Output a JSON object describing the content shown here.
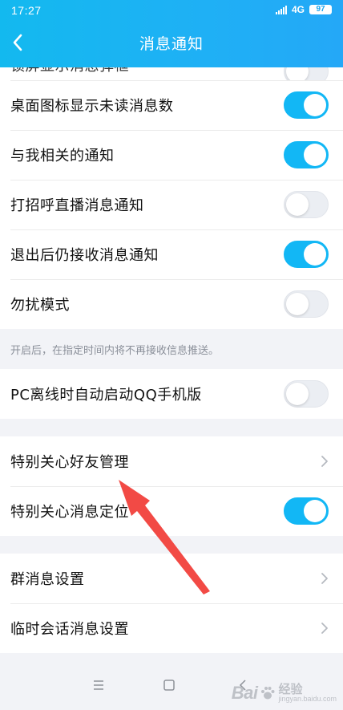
{
  "status_bar": {
    "time": "17:27",
    "network": "4G",
    "battery": "97"
  },
  "header": {
    "title": "消息通知"
  },
  "rows": {
    "cut": {
      "label": "锁屏显示消息弹框",
      "on": false
    },
    "desktop_badge": {
      "label": "桌面图标显示未读消息数",
      "on": true
    },
    "related": {
      "label": "与我相关的通知",
      "on": true
    },
    "greet_live": {
      "label": "打招呼直播消息通知",
      "on": false
    },
    "after_exit": {
      "label": "退出后仍接收消息通知",
      "on": true
    },
    "dnd": {
      "label": "勿扰模式",
      "on": false
    },
    "pc_offline": {
      "label": "PC离线时自动启动QQ手机版",
      "on": false
    },
    "special_friends": {
      "label": "特别关心好友管理"
    },
    "special_locate": {
      "label": "特别关心消息定位",
      "on": true
    },
    "group_settings": {
      "label": "群消息设置"
    },
    "temp_chat": {
      "label": "临时会话消息设置"
    }
  },
  "hint": {
    "dnd": "开启后，在指定时间内将不再接收信息推送。"
  },
  "colors": {
    "accent": "#12b7f5",
    "arrow": "#f24a45"
  },
  "watermark": {
    "logo": "Bai",
    "name": "经验",
    "url": "jingyan.baidu.com"
  }
}
